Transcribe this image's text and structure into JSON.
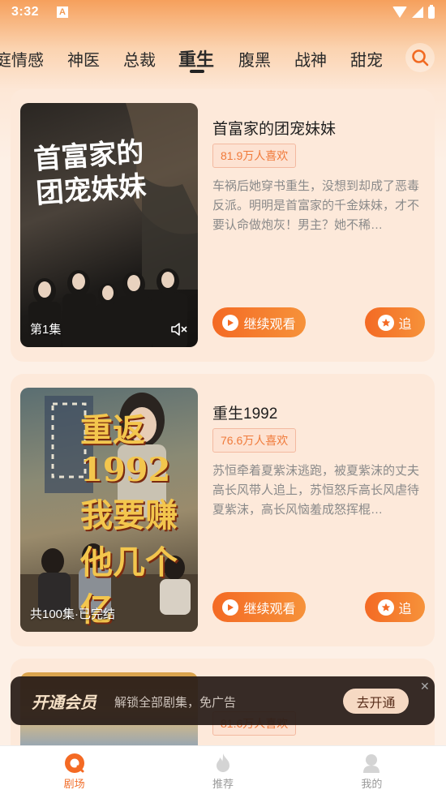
{
  "status_bar": {
    "time": "3:32",
    "notification_letter": "A"
  },
  "tabs": [
    {
      "label": "庭情感",
      "active": false
    },
    {
      "label": "神医",
      "active": false
    },
    {
      "label": "总裁",
      "active": false
    },
    {
      "label": "重生",
      "active": true
    },
    {
      "label": "腹黑",
      "active": false
    },
    {
      "label": "战神",
      "active": false
    },
    {
      "label": "甜宠",
      "active": false
    }
  ],
  "cards": [
    {
      "title": "首富家的团宠妹妹",
      "likes": "81.9万人喜欢",
      "description": "车祸后她穿书重生，没想到却成了恶毒反派。明明是首富家的千金妹妹，才不要认命做炮灰！男主？她不稀…",
      "episode_label": "第1集",
      "poster_art": "首富家的团宠妹妹",
      "watch_label": "继续观看",
      "follow_label": "追"
    },
    {
      "title": "重生1992",
      "likes": "76.6万人喜欢",
      "description": "苏恒牵着夏紫沫逃跑，被夏紫沫的丈夫高长风带人追上，苏恒怒斥高长风虐待夏紫沫，高长风恼羞成怒挥棍…",
      "episode_label": "共100集·已完结",
      "poster_art": "重返1992 我要赚他几个亿",
      "watch_label": "继续观看",
      "follow_label": "追"
    },
    {
      "likes": "81.6万人喜欢"
    }
  ],
  "vip_banner": {
    "title": "开通会员",
    "description": "解锁全部剧集，免广告",
    "button": "去开通",
    "close": "✕"
  },
  "bottom_nav": [
    {
      "label": "剧场",
      "icon": "theater-icon",
      "active": true
    },
    {
      "label": "推荐",
      "icon": "flame-icon",
      "active": false
    },
    {
      "label": "我的",
      "icon": "profile-icon",
      "active": false
    }
  ],
  "colors": {
    "accent": "#f46a24",
    "background": "#fdf0e6",
    "card": "#fde9da"
  }
}
